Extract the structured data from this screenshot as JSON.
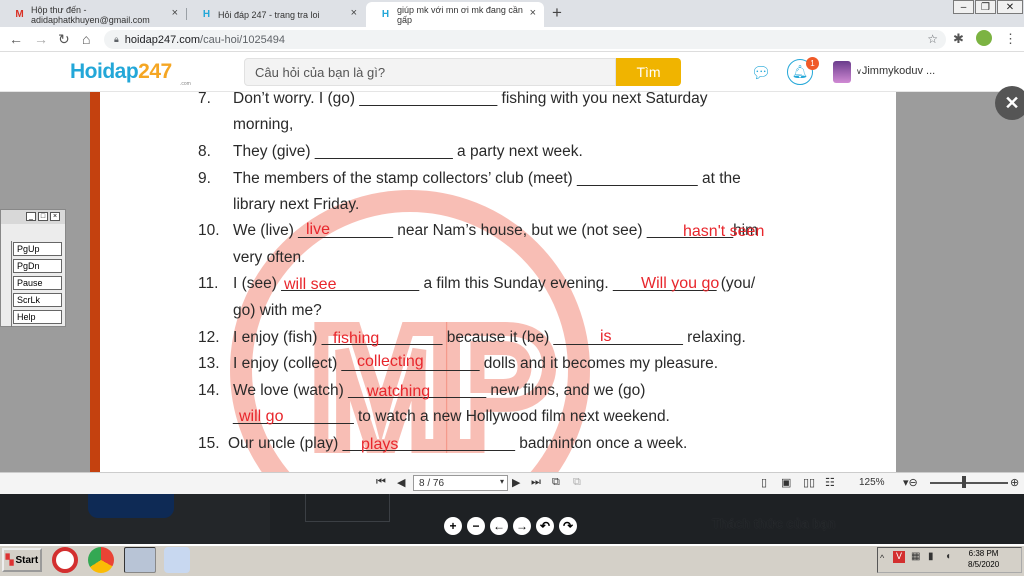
{
  "browser": {
    "tabs": [
      {
        "label": "Hộp thư đến - adidaphatkhuyen@gmail.com",
        "icon": "gmail-icon"
      },
      {
        "label": "Hỏi đáp 247 - trang tra loi",
        "icon": "hoidap-icon"
      },
      {
        "label": "giúp mk với mn ơi mk đang cần gấp",
        "icon": "hoidap-icon"
      }
    ],
    "url_host": "hoidap247.com",
    "url_path": "/cau-hoi/1025494"
  },
  "site": {
    "logo_main": "Hoidap",
    "logo_num": "247",
    "logo_sub": ".com",
    "search_placeholder": "Câu hỏi của bạn là gì?",
    "search_button": "Tìm",
    "notification_count": "1",
    "username": "Jimmykoduv ..."
  },
  "worksheet": {
    "lines": [
      {
        "num": "7.",
        "text": "Don’t worry. I (go) ________________ fishing with you next Saturday"
      },
      {
        "num": "",
        "text": "morning,"
      },
      {
        "num": "8.",
        "text": "They (give) ________________ a party next week."
      },
      {
        "num": "9.",
        "text": "The members of the stamp collectors’ club (meet) ______________ at the"
      },
      {
        "num": "",
        "text": "library next Friday."
      },
      {
        "num": "10.",
        "text": "We (live) ___________ near Nam’s house, but we (not see) __________him"
      },
      {
        "num": "",
        "text": "very often."
      },
      {
        "num": "11.",
        "text": "I (see) ________________ a film this Sunday evening. ____________ (you/"
      },
      {
        "num": "",
        "text": "go) with me?"
      },
      {
        "num": "12.",
        "text": "I enjoy (fish) ______________ because it (be) _______________ relaxing."
      },
      {
        "num": "13.",
        "text": "I enjoy (collect) ________________ dolls and it becomes my pleasure."
      },
      {
        "num": "14.",
        "text": "We love (watch) ________________ new films, and we (go)"
      },
      {
        "num": "",
        "text": "______________ to watch a new Hollywood film next weekend."
      },
      {
        "num": "15.",
        "text": "Our uncle (play) ____________________ badminton once a week."
      }
    ],
    "answers": [
      "live",
      "hasn't seen",
      "will see",
      "Will you go",
      "fishing",
      "is",
      "collecting",
      "watching",
      "will go",
      "plays"
    ],
    "watermark": "MP"
  },
  "viewer": {
    "page_indicator": "8 / 76",
    "zoom": "125%"
  },
  "bottom": {
    "challenge_text": "Thách thức của bạn"
  },
  "keyboard_panel": {
    "keys": [
      "PgUp",
      "PgDn",
      "Pause",
      "ScrLk",
      "Help"
    ]
  },
  "taskbar": {
    "start_label": "Start",
    "time": "6:38 PM",
    "date": "8/5/2020"
  }
}
